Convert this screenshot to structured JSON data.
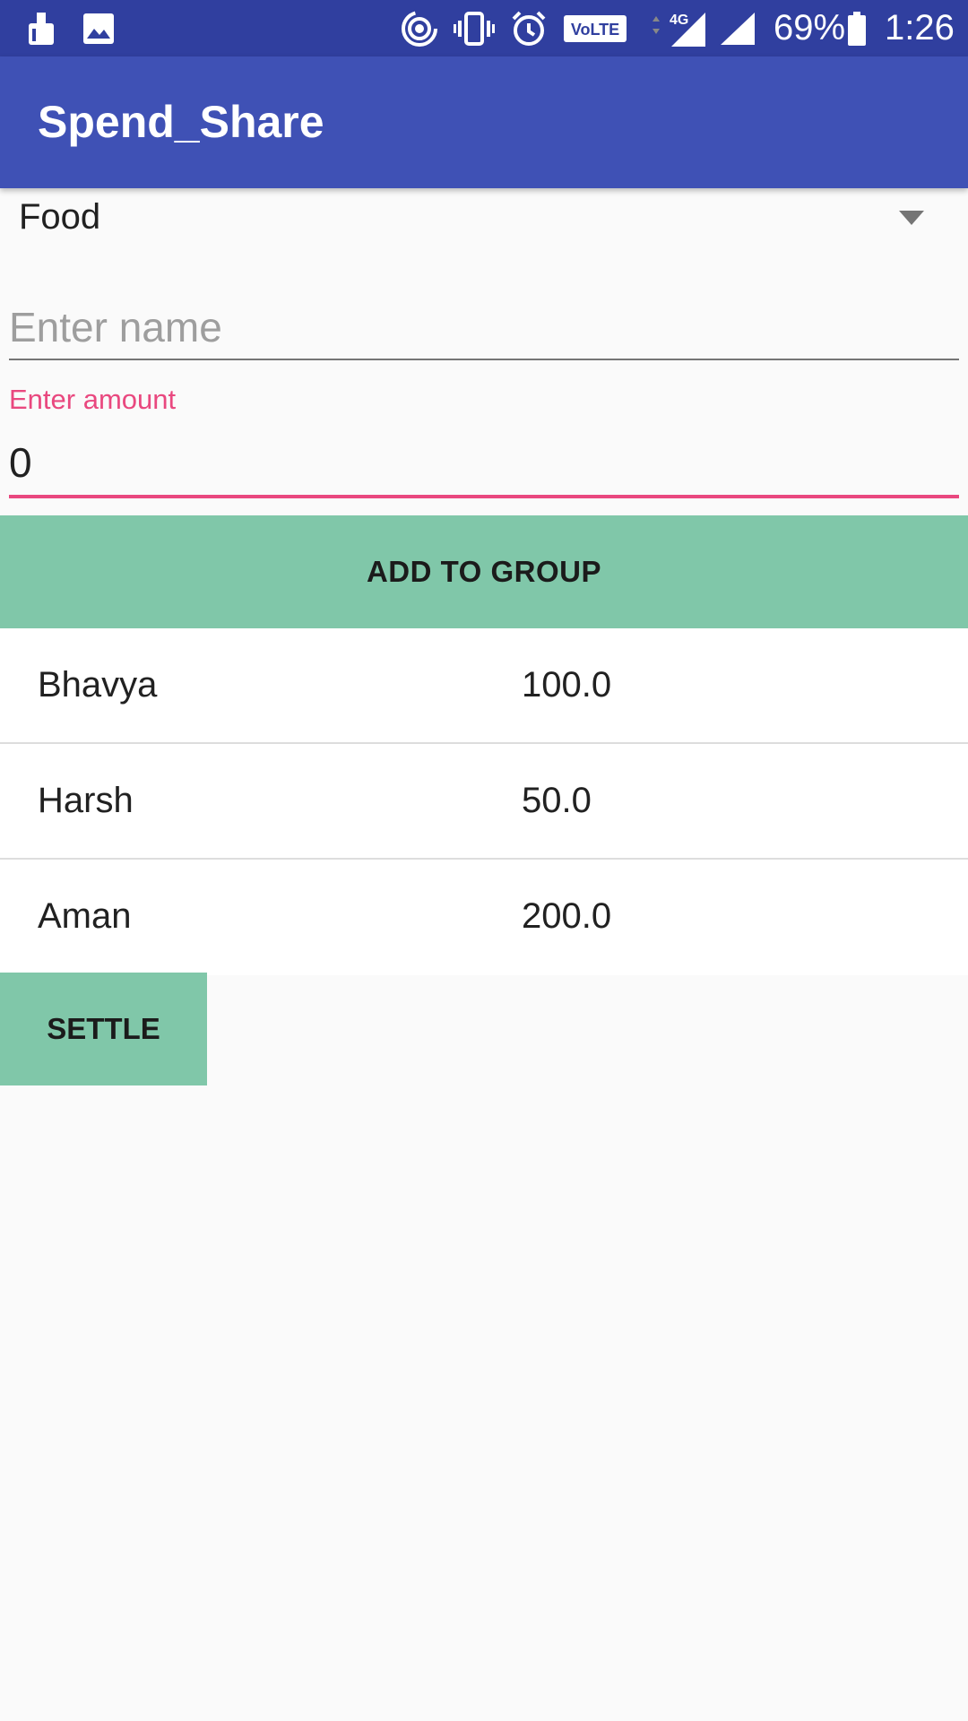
{
  "status_bar": {
    "battery_percent": "69%",
    "time": "1:26",
    "network_label": "4G",
    "volte_label": "VoLTE",
    "icons": [
      "cleaner-icon",
      "image-icon",
      "hotspot-icon",
      "vibrate-icon",
      "alarm-icon",
      "volte-icon",
      "signal-4g-icon",
      "signal-icon",
      "battery-icon"
    ]
  },
  "app_bar": {
    "title": "Spend_Share"
  },
  "form": {
    "category_selected": "Food",
    "name_placeholder": "Enter name",
    "name_value": "",
    "amount_label": "Enter amount",
    "amount_value": "0",
    "add_button": "ADD TO GROUP",
    "settle_button": "SETTLE"
  },
  "members": [
    {
      "name": "Bhavya",
      "amount": "100.0"
    },
    {
      "name": "Harsh",
      "amount": "50.0"
    },
    {
      "name": "Aman",
      "amount": "200.0"
    }
  ],
  "colors": {
    "status_bar": "#303f9f",
    "app_bar": "#3f51b5",
    "accent": "#e9487f",
    "button": "#80c7a9"
  }
}
